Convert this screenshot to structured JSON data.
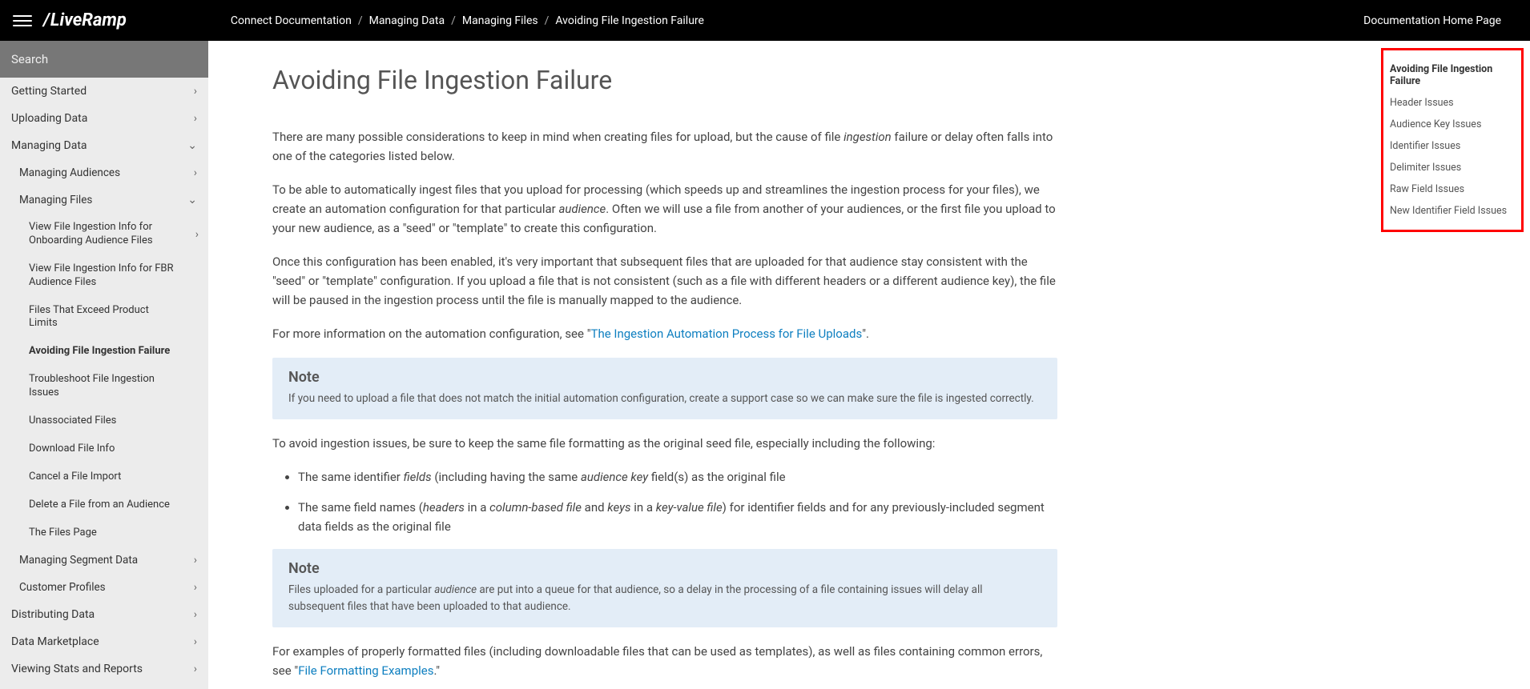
{
  "header": {
    "logo_slash": "/",
    "logo_text": "LiveRamp",
    "breadcrumb": [
      "Connect Documentation",
      "Managing Data",
      "Managing Files",
      "Avoiding File Ingestion Failure"
    ],
    "home_link": "Documentation Home Page"
  },
  "search": {
    "placeholder": "Search"
  },
  "sidebar_lvl1": {
    "getting_started": "Getting Started",
    "uploading_data": "Uploading Data",
    "managing_data": "Managing Data",
    "distributing_data": "Distributing Data",
    "data_marketplace": "Data Marketplace",
    "viewing_stats": "Viewing Stats and Reports"
  },
  "sidebar_lvl2": {
    "managing_audiences": "Managing Audiences",
    "managing_files": "Managing Files",
    "managing_segment_data": "Managing Segment Data",
    "customer_profiles": "Customer Profiles"
  },
  "sidebar_lvl3": {
    "view_onboarding": "View File Ingestion Info for Onboarding Audience Files",
    "view_fbr": "View File Ingestion Info for FBR Audience Files",
    "exceed_limits": "Files That Exceed Product Limits",
    "avoiding": "Avoiding File Ingestion Failure",
    "troubleshoot": "Troubleshoot File Ingestion Issues",
    "unassociated": "Unassociated Files",
    "download": "Download File Info",
    "cancel": "Cancel a File Import",
    "delete": "Delete a File from an Audience",
    "files_page": "The Files Page"
  },
  "glyph": {
    "chev_right": "›",
    "chev_down": "⌄"
  },
  "article": {
    "title": "Avoiding File Ingestion Failure",
    "p1_a": "There are many possible considerations to keep in mind when creating files for upload, but the cause of file ",
    "p1_em": "ingestion",
    "p1_b": " failure or delay often falls into one of the categories listed below.",
    "p2_a": "To be able to automatically ingest files that you upload for processing (which speeds up and streamlines the ingestion process for your files), we create an automation configuration for that particular ",
    "p2_em": "audience",
    "p2_b": ". Often we will use a file from another of your audiences, or the first file you upload to your new audience, as a \"seed\" or \"template\" to create this configuration.",
    "p3": "Once this configuration has been enabled, it's very important that subsequent files that are uploaded for that audience stay consistent with the \"seed\" or \"template\" configuration. If you upload a file that is not consistent (such as a file with different headers or a different audience key), the file will be paused in the ingestion process until the file is manually mapped to the audience.",
    "p4_a": "For more information on the automation configuration, see \"",
    "p4_link": "The Ingestion Automation Process for File Uploads",
    "p4_b": "\".",
    "note1_title": "Note",
    "note1_body": "If you need to upload a file that does not match the initial automation configuration, create a support case so we can make sure the file is ingested correctly.",
    "p5": "To avoid ingestion issues, be sure to keep the same file formatting as the original seed file, especially including the following:",
    "li1_a": "The same identifier ",
    "li1_em1": "fields",
    "li1_b": " (including having the same ",
    "li1_em2": "audience key",
    "li1_c": " field(s) as the original file",
    "li2_a": "The same field names (",
    "li2_em1": "headers",
    "li2_b": " in a ",
    "li2_em2": "column-based file",
    "li2_c": " and ",
    "li2_em3": "keys",
    "li2_d": " in a ",
    "li2_em4": "key-value file",
    "li2_e": ") for identifier fields and for any previously-included segment data fields as the original file",
    "note2_title": "Note",
    "note2_body_a": "Files uploaded for a particular ",
    "note2_body_em": "audience",
    "note2_body_b": " are put into a queue for that audience, so a delay in the processing of a file containing issues will delay all subsequent files that have been uploaded to that audience.",
    "p6_a": "For examples of properly formatted files (including downloadable files that can be used as templates), as well as files containing common errors, see \"",
    "p6_link": "File Formatting Examples",
    "p6_b": ".\""
  },
  "toc": {
    "t0": "Avoiding File Ingestion Failure",
    "t1": "Header Issues",
    "t2": "Audience Key Issues",
    "t3": "Identifier Issues",
    "t4": "Delimiter Issues",
    "t5": "Raw Field Issues",
    "t6": "New Identifier Field Issues"
  }
}
